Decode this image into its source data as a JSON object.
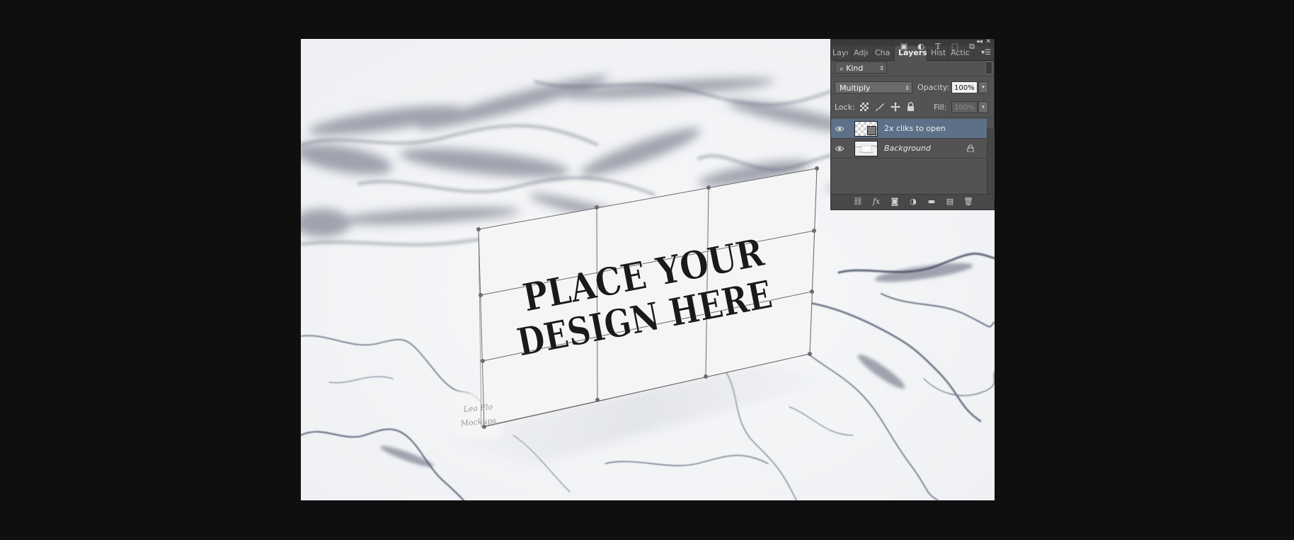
{
  "canvas": {
    "mockup_text_line1": "PLACE YOUR",
    "mockup_text_line2": "DESIGN HERE",
    "watermark_line1": "Lea Flo",
    "watermark_line2": "Mockups"
  },
  "panel": {
    "tabs": [
      {
        "label": "Layı",
        "active": false
      },
      {
        "label": "Adjı",
        "active": false
      },
      {
        "label": "Cha",
        "active": false
      },
      {
        "label": "Layers",
        "active": true
      },
      {
        "label": "Hist",
        "active": false
      },
      {
        "label": "Actic",
        "active": false
      }
    ],
    "filter": {
      "kind_label": "Kind"
    },
    "blend_mode": "Multiply",
    "opacity_label": "Opacity:",
    "opacity_value": "100%",
    "lock_label": "Lock:",
    "fill_label": "Fill:",
    "fill_value": "100%",
    "layers": [
      {
        "name": "2x cliks to open",
        "selected": true,
        "visible": true,
        "locked": false
      },
      {
        "name": "Background",
        "selected": false,
        "visible": true,
        "locked": true
      }
    ],
    "bottom_icons": [
      "link-icon",
      "fx-icon",
      "mask-icon",
      "adjustment-icon",
      "folder-icon",
      "new-layer-icon",
      "trash-icon"
    ]
  },
  "colors": {
    "app_background": "#0f0f0f",
    "panel_background": "#535353",
    "selected_layer": "#5e7088",
    "marble_base": "#eef0f3",
    "vein": "#4a4f63"
  }
}
